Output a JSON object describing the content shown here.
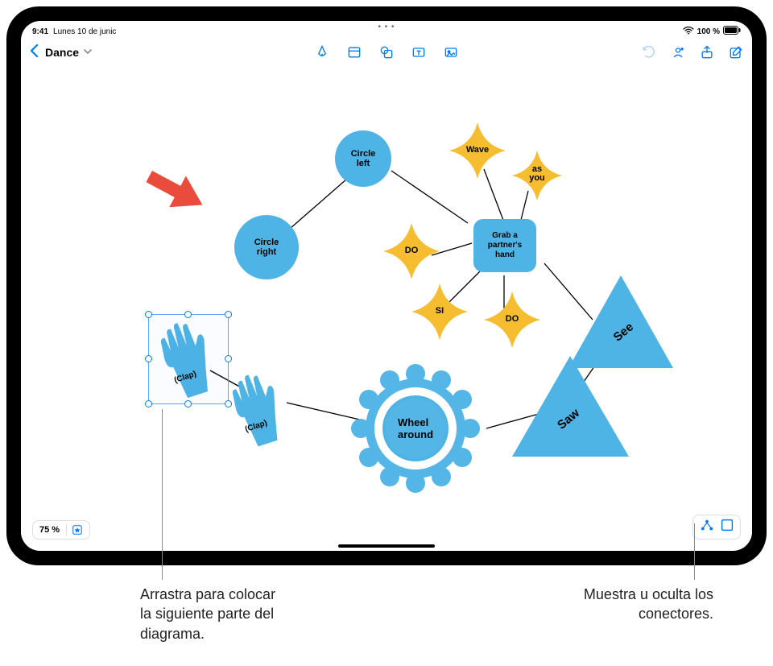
{
  "statusbar": {
    "time": "9:41",
    "date": "Lunes 10 de junic",
    "wifi": "wifi",
    "battery_pct": "100 %"
  },
  "toolbar": {
    "doc_title": "Dance",
    "back": "back",
    "tools": [
      "pen",
      "note",
      "shape",
      "textbox",
      "image"
    ],
    "right_tools": [
      "undo",
      "collab",
      "share",
      "compose"
    ]
  },
  "bottom_controls": {
    "zoom": "75 %"
  },
  "nodes": {
    "circle_left": "Circle\nleft",
    "circle_right": "Circle\nright",
    "wave": "Wave",
    "as_you": "as\nyou",
    "do1": "DO",
    "do2": "DO",
    "si": "SI",
    "grab": "Grab a\npartner's\nhand",
    "see": "See",
    "saw": "Saw",
    "wheel": "Wheel\naround",
    "clap1": "(Clap)",
    "clap2": "(Clap)"
  },
  "callouts": {
    "left": "Arrastra para colocar\nla siguiente parte del\ndiagrama.",
    "right": "Muestra u oculta los\nconectores."
  }
}
